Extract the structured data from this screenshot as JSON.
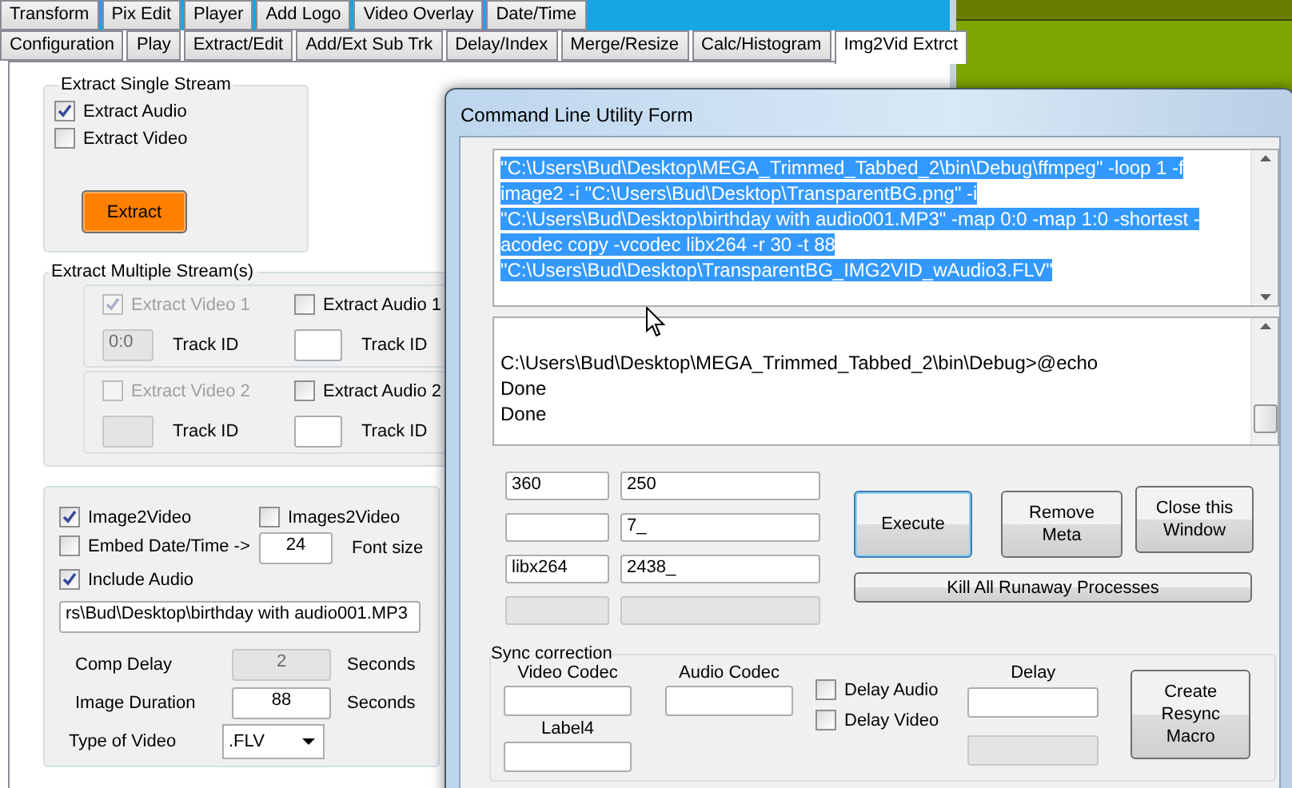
{
  "main_window": {
    "tab_rows": [
      [
        {
          "label": "Transform",
          "selected": false
        },
        {
          "label": "Pix Edit",
          "selected": false
        },
        {
          "label": "Player",
          "selected": false
        },
        {
          "label": "Add Logo",
          "selected": false
        },
        {
          "label": "Video Overlay",
          "selected": false
        },
        {
          "label": "Date/Time",
          "selected": false
        }
      ],
      [
        {
          "label": "Configuration",
          "selected": false
        },
        {
          "label": "Play",
          "selected": false
        },
        {
          "label": "Extract/Edit",
          "selected": false
        },
        {
          "label": "Add/Ext Sub Trk",
          "selected": false
        },
        {
          "label": "Delay/Index",
          "selected": false
        },
        {
          "label": "Merge/Resize",
          "selected": false
        },
        {
          "label": "Calc/Histogram",
          "selected": false
        },
        {
          "label": "Img2Vid Extrct",
          "selected": true
        }
      ]
    ],
    "extract_single": {
      "title": "Extract Single Stream",
      "checkboxes": [
        {
          "label": "Extract Audio",
          "checked": true
        },
        {
          "label": "Extract Video",
          "checked": false
        }
      ],
      "button": "Extract"
    },
    "extract_multiple": {
      "title": "Extract Multiple Stream(s)",
      "groups": [
        {
          "video": {
            "label": "Extract Video 1",
            "checked": true,
            "disabled": true
          },
          "video_track": {
            "value": "0:0",
            "label": "Track ID",
            "disabled": true
          },
          "audio": {
            "label": "Extract Audio 1",
            "checked": false,
            "disabled": false
          },
          "audio_track": {
            "label": "Track ID",
            "disabled": false
          }
        },
        {
          "video": {
            "label": "Extract Video 2",
            "checked": false,
            "disabled": true
          },
          "video_track": {
            "label": "Track ID",
            "disabled": true
          },
          "audio": {
            "label": "Extract Audio 2",
            "checked": false,
            "disabled": false
          },
          "audio_track": {
            "label": "Track ID",
            "disabled": false
          }
        }
      ]
    },
    "image_to_video": {
      "checkboxes": [
        {
          "label": "Image2Video",
          "checked": true
        },
        {
          "label": "Images2Video",
          "checked": false
        },
        {
          "label": "Embed Date/Time ->",
          "checked": false
        },
        {
          "label": "Include Audio",
          "checked": true
        }
      ],
      "font_size": {
        "value": "24",
        "label": "Font size"
      },
      "audio_path": "rs\\Bud\\Desktop\\birthday with audio001.MP3",
      "rows": [
        {
          "label": "Comp Delay",
          "value": "2",
          "unit": "Seconds",
          "disabled": true
        },
        {
          "label": "Image Duration",
          "value": "88",
          "unit": "Seconds",
          "disabled": false
        }
      ],
      "video_type": {
        "label": "Type of Video",
        "value": ".FLV"
      }
    }
  },
  "dialog": {
    "title": "Command Line Utility Form",
    "command": "\"C:\\Users\\Bud\\Desktop\\MEGA_Trimmed_Tabbed_2\\bin\\Debug\\ffmpeg\" -loop 1 -f image2 -i \"C:\\Users\\Bud\\Desktop\\TransparentBG.png\" -i \"C:\\Users\\Bud\\Desktop\\birthday with audio001.MP3\" -map 0:0 -map 1:0 -shortest -acodec copy -vcodec libx264 -r 30 -t 88 \"C:\\Users\\Bud\\Desktop\\TransparentBG_IMG2VID_wAudio3.FLV\"",
    "output_lines": [
      "C:\\Users\\Bud\\Desktop\\MEGA_Trimmed_Tabbed_2\\bin\\Debug>@echo",
      "Done",
      "Done"
    ],
    "fields": [
      {
        "a": "360",
        "b": "250",
        "disabled": false
      },
      {
        "b": "7_",
        "disabled": false
      },
      {
        "a": "libx264",
        "b": "2438_",
        "disabled": false
      },
      {
        "disabled": true
      }
    ],
    "buttons": [
      {
        "label": "Execute",
        "focused": true
      },
      {
        "label": "Remove Meta",
        "focused": false
      },
      {
        "label": "Close this Window",
        "focused": false
      }
    ],
    "kill_button": "Kill All Runaway Processes",
    "sync": {
      "title": "Sync correction",
      "video_codec": "Video Codec",
      "label4": "Label4",
      "audio_codec": "Audio Codec",
      "checkboxes": [
        {
          "label": "Delay Audio",
          "checked": false
        },
        {
          "label": "Delay Video",
          "checked": false
        }
      ],
      "delay": "Delay",
      "button": "Create Resync Macro"
    }
  }
}
